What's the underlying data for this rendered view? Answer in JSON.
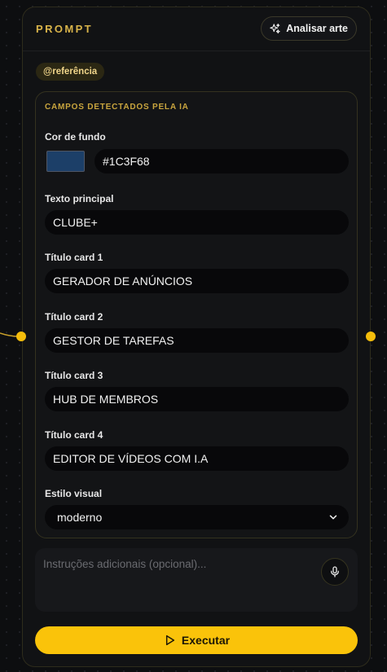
{
  "node": {
    "title": "PROMPT",
    "analyze_label": "Analisar arte",
    "reference_chip": "@referência"
  },
  "fields_panel": {
    "title": "CAMPOS DETECTADOS PELA IA",
    "background_color": {
      "label": "Cor de fundo",
      "value": "#1C3F68",
      "swatch": "#1C3F68"
    },
    "main_text": {
      "label": "Texto principal",
      "value": "CLUBE+"
    },
    "card1": {
      "label": "Título card 1",
      "value": "GERADOR DE ANÚNCIOS"
    },
    "card2": {
      "label": "Título card 2",
      "value": "GESTOR DE TAREFAS"
    },
    "card3": {
      "label": "Título card 3",
      "value": "HUB DE MEMBROS"
    },
    "card4": {
      "label": "Título card 4",
      "value": "EDITOR DE VÍDEOS COM I.A"
    },
    "visual_style": {
      "label": "Estilo visual",
      "value": "moderno"
    }
  },
  "instructions": {
    "placeholder": "Instruções adicionais (opcional)..."
  },
  "execute_label": "Executar",
  "colors": {
    "accent": "#F5BD0B",
    "node_background": "#111214",
    "input_background": "#08080A"
  },
  "icons": {
    "analyze": "sparkles-icon",
    "mic": "microphone-icon",
    "execute": "play-icon",
    "select": "chevron-down-icon"
  }
}
